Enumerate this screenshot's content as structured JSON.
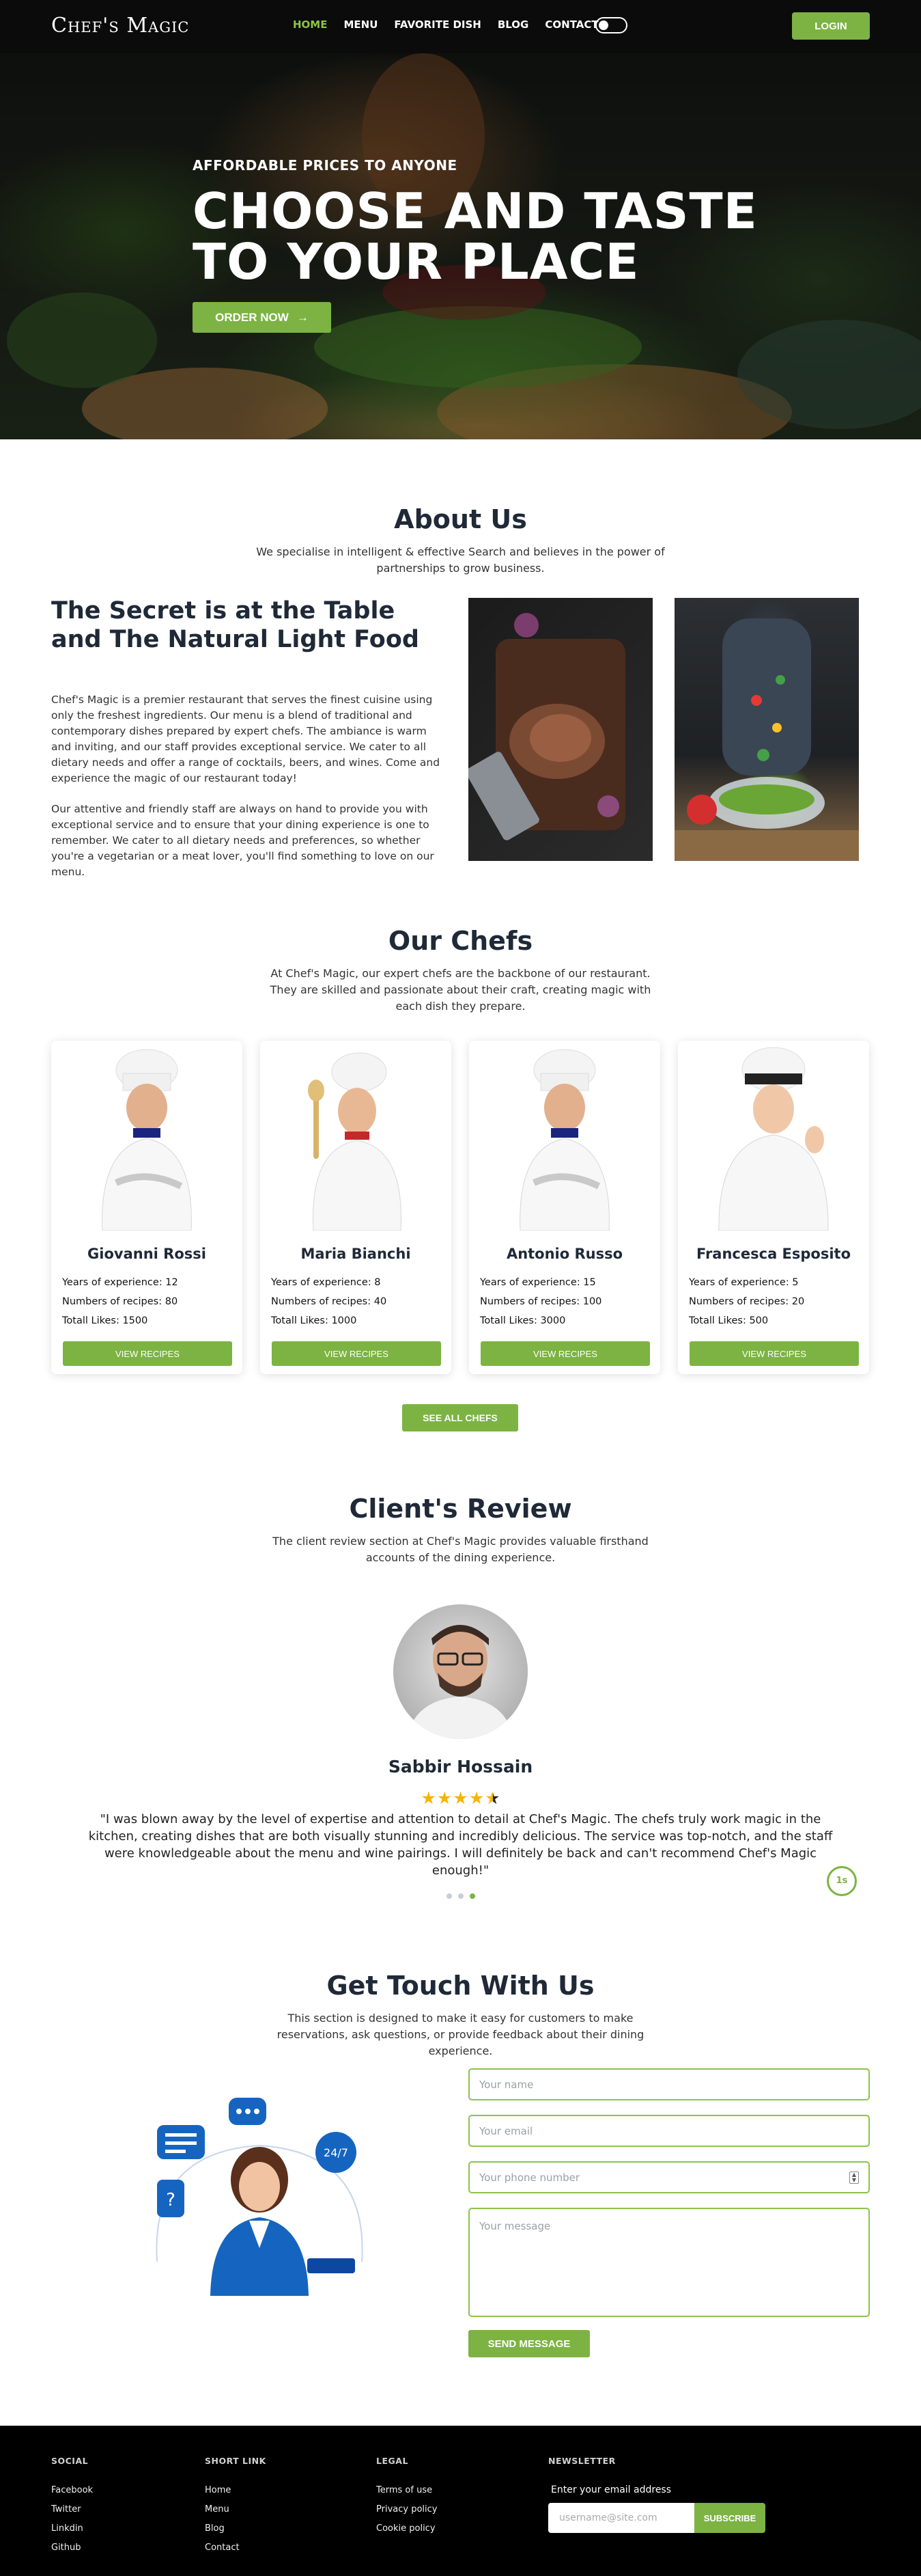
{
  "nav": {
    "brand": "Chef's Magic",
    "links": [
      "HOME",
      "MENU",
      "FAVORITE DISH",
      "BLOG",
      "CONTACT"
    ],
    "login": "LOGIN"
  },
  "hero": {
    "kicker": "AFFORDABLE PRICES TO ANYONE",
    "title": "CHOOSE AND TASTE TO YOUR PLACE",
    "cta": "ORDER NOW"
  },
  "about": {
    "title": "About Us",
    "subtitle": "We specialise in intelligent & effective Search and believes in the power of partnerships to grow business.",
    "heading": "The Secret is at the Table and The Natural Light Food",
    "para1": "Chef's Magic is a premier restaurant that serves the finest cuisine using only the freshest ingredients. Our menu is a blend of traditional and contemporary dishes prepared by expert chefs. The ambiance is warm and inviting, and our staff provides exceptional service. We cater to all dietary needs and offer a range of cocktails, beers, and wines. Come and experience the magic of our restaurant today!",
    "para2": "Our attentive and friendly staff are always on hand to provide you with exceptional service and to ensure that your dining experience is one to remember. We cater to all dietary needs and preferences, so whether you're a vegetarian or a meat lover, you'll find something to love on our menu."
  },
  "chefs": {
    "title": "Our Chefs",
    "subtitle": "At Chef's Magic, our expert chefs are the backbone of our restaurant. They are skilled and passionate about their craft, creating magic with each dish they prepare.",
    "cards": [
      {
        "name": "Giovanni Rossi",
        "experience": "Years of experience: 12",
        "recipes": "Numbers of recipes: 80",
        "likes": "Totall Likes: 1500",
        "button": "VIEW RECIPES"
      },
      {
        "name": "Maria Bianchi",
        "experience": "Years of experience: 8",
        "recipes": "Numbers of recipes: 40",
        "likes": "Totall Likes: 1000",
        "button": "VIEW RECIPES"
      },
      {
        "name": "Antonio Russo",
        "experience": "Years of experience: 15",
        "recipes": "Numbers of recipes: 100",
        "likes": "Totall Likes: 3000",
        "button": "VIEW RECIPES"
      },
      {
        "name": "Francesca Esposito",
        "experience": "Years of experience: 5",
        "recipes": "Numbers of recipes: 20",
        "likes": "Totall Likes: 500",
        "button": "VIEW RECIPES"
      }
    ],
    "see_all": "SEE ALL CHEFS"
  },
  "review": {
    "title": "Client's Review",
    "subtitle": "The client review section at Chef's Magic provides valuable firsthand accounts of the dining experience.",
    "name": "Sabbir Hossain",
    "rating": 4.5,
    "text": "\"I was blown away by the level of expertise and attention to detail at Chef's Magic. The chefs truly work magic in the kitchen, creating dishes that are both visually stunning and incredibly delicious. The service was top-notch, and the staff were knowledgeable about the menu and wine pairings. I will definitely be back and can't recommend Chef's Magic enough!\"",
    "timer": "1s",
    "active_dot": 3
  },
  "contact": {
    "title": "Get Touch With Us",
    "subtitle": "This section is designed to make it easy for customers to make reservations, ask questions, or provide feedback about their dining experience.",
    "placeholders": {
      "name": "Your name",
      "email": "Your email",
      "phone": "Your phone number",
      "message": "Your message"
    },
    "send": "SEND MESSAGE"
  },
  "footer": {
    "social": {
      "title": "SOCIAL",
      "items": [
        "Facebook",
        "Twitter",
        "Linkdin",
        "Github"
      ]
    },
    "short": {
      "title": "SHORT LINK",
      "items": [
        "Home",
        "Menu",
        "Blog",
        "Contact"
      ]
    },
    "legal": {
      "title": "LEGAL",
      "items": [
        "Terms of use",
        "Privacy policy",
        "Cookie policy"
      ]
    },
    "newsletter": {
      "title": "NEWSLETTER",
      "label": "Enter your email address",
      "placeholder": "username@site.com",
      "button": "SUBSCRIBE"
    }
  },
  "colors": {
    "accent": "#7cb342",
    "nav_bg": "#0b0b0b",
    "footer_bg": "#000000",
    "star": "#f5b50a"
  }
}
